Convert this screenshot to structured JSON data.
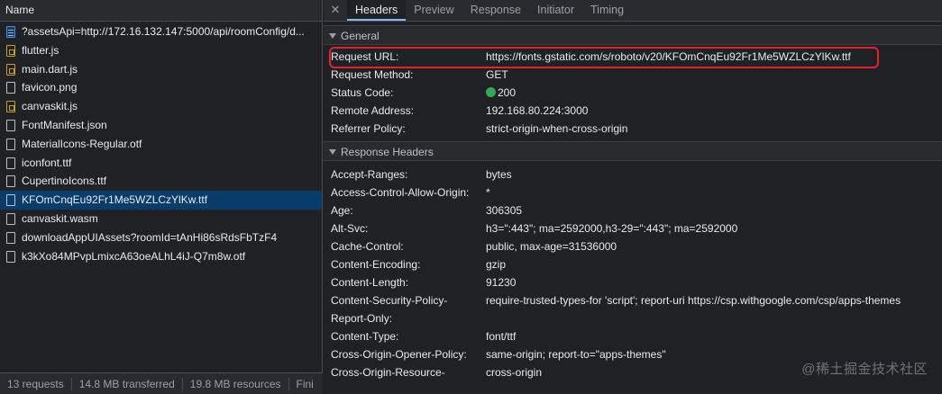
{
  "left_panel": {
    "column_header": "Name",
    "requests": [
      {
        "name": "?assetsApi=http://172.16.132.147:5000/api/roomConfig/d...",
        "icon": "document-icon",
        "type": "doc"
      },
      {
        "name": "flutter.js",
        "icon": "script-file-icon",
        "type": "js"
      },
      {
        "name": "main.dart.js",
        "icon": "script-file-icon",
        "type": "js"
      },
      {
        "name": "favicon.png",
        "icon": "file-icon",
        "type": "plain"
      },
      {
        "name": "canvaskit.js",
        "icon": "script-file-icon",
        "type": "js"
      },
      {
        "name": "FontManifest.json",
        "icon": "file-icon",
        "type": "plain"
      },
      {
        "name": "MaterialIcons-Regular.otf",
        "icon": "file-icon",
        "type": "plain"
      },
      {
        "name": "iconfont.ttf",
        "icon": "file-icon",
        "type": "plain"
      },
      {
        "name": "CupertinoIcons.ttf",
        "icon": "file-icon",
        "type": "plain"
      },
      {
        "name": "KFOmCnqEu92Fr1Me5WZLCzYlKw.ttf",
        "icon": "file-icon",
        "type": "plain",
        "selected": true
      },
      {
        "name": "canvaskit.wasm",
        "icon": "file-icon",
        "type": "plain"
      },
      {
        "name": "downloadAppUIAssets?roomId=tAnHi86sRdsFbTzF4",
        "icon": "file-icon",
        "type": "plain"
      },
      {
        "name": "k3kXo84MPvpLmixcA63oeALhL4iJ-Q7m8w.otf",
        "icon": "file-icon",
        "type": "plain"
      }
    ],
    "status": {
      "requests": "13 requests",
      "transferred": "14.8 MB transferred",
      "resources": "19.8 MB resources",
      "finish": "Fini"
    }
  },
  "detail_tabs": {
    "close": "✕",
    "items": [
      "Headers",
      "Preview",
      "Response",
      "Initiator",
      "Timing"
    ],
    "active": "Headers"
  },
  "general": {
    "title": "General",
    "rows": [
      {
        "key": "Request URL:",
        "value": "https://fonts.gstatic.com/s/roboto/v20/KFOmCnqEu92Fr1Me5WZLCzYlKw.ttf"
      },
      {
        "key": "Request Method:",
        "value": "GET"
      },
      {
        "key": "Status Code:",
        "value": "200",
        "status_color": "#34a853"
      },
      {
        "key": "Remote Address:",
        "value": "192.168.80.224:3000"
      },
      {
        "key": "Referrer Policy:",
        "value": "strict-origin-when-cross-origin"
      }
    ]
  },
  "response_headers": {
    "title": "Response Headers",
    "rows": [
      {
        "key": "Accept-Ranges:",
        "value": "bytes"
      },
      {
        "key": "Access-Control-Allow-Origin:",
        "value": "*"
      },
      {
        "key": "Age:",
        "value": "306305"
      },
      {
        "key": "Alt-Svc:",
        "value": "h3=\":443\"; ma=2592000,h3-29=\":443\"; ma=2592000"
      },
      {
        "key": "Cache-Control:",
        "value": "public, max-age=31536000"
      },
      {
        "key": "Content-Encoding:",
        "value": "gzip"
      },
      {
        "key": "Content-Length:",
        "value": "91230"
      },
      {
        "key": "Content-Security-Policy-",
        "value": "require-trusted-types-for 'script'; report-uri https://csp.withgoogle.com/csp/apps-themes"
      },
      {
        "key": "Report-Only:",
        "value": ""
      },
      {
        "key": "Content-Type:",
        "value": "font/ttf"
      },
      {
        "key": "Cross-Origin-Opener-Policy:",
        "value": "same-origin; report-to=\"apps-themes\""
      },
      {
        "key": "Cross-Origin-Resource-",
        "value": "cross-origin"
      }
    ]
  },
  "watermark": "@稀土掘金技术社区",
  "colors": {
    "highlight": "#e0242a",
    "selected_row": "#083c6b",
    "active_tab": "#8ab4f8"
  }
}
